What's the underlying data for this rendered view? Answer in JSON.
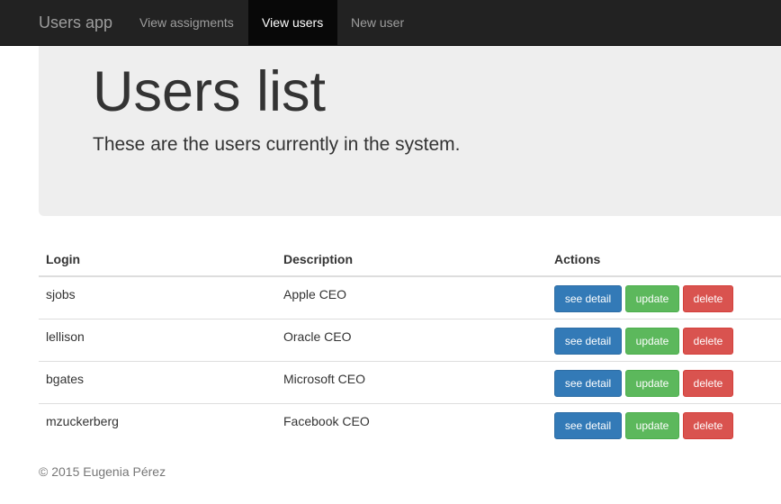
{
  "navbar": {
    "brand": "Users app",
    "items": [
      {
        "label": "View assigments",
        "active": false
      },
      {
        "label": "View users",
        "active": true
      },
      {
        "label": "New user",
        "active": false
      }
    ]
  },
  "jumbotron": {
    "title": "Users list",
    "subtitle": "These are the users currently in the system."
  },
  "table": {
    "headers": {
      "login": "Login",
      "description": "Description",
      "actions": "Actions"
    },
    "rows": [
      {
        "login": "sjobs",
        "description": "Apple CEO"
      },
      {
        "login": "lellison",
        "description": "Oracle CEO"
      },
      {
        "login": "bgates",
        "description": "Microsoft CEO"
      },
      {
        "login": "mzuckerberg",
        "description": "Facebook CEO"
      }
    ],
    "actions": {
      "detail": "see detail",
      "update": "update",
      "delete": "delete"
    }
  },
  "footer": {
    "text": "© 2015 Eugenia Pérez"
  },
  "colors": {
    "navbar_bg": "#222222",
    "active_nav_bg": "#080808",
    "primary": "#337ab7",
    "success": "#5cb85c",
    "danger": "#d9534f",
    "jumbotron_bg": "#eeeeee"
  }
}
